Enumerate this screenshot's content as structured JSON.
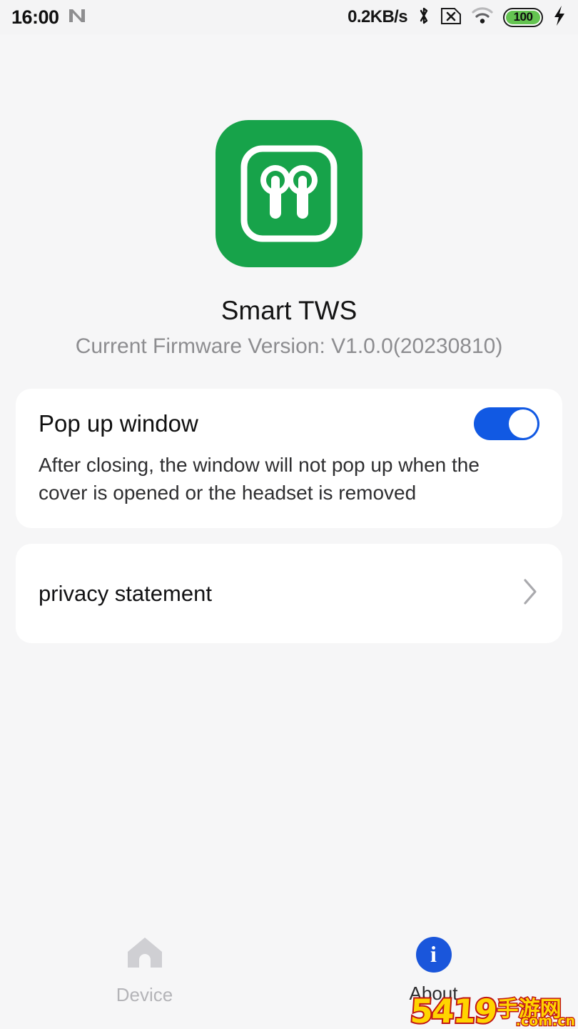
{
  "status_bar": {
    "time": "16:00",
    "nfc_icon": "nfc-icon",
    "network_speed": "0.2KB/s",
    "bluetooth_icon": "bluetooth-icon",
    "sim_icon": "sim-card-x-icon",
    "wifi_icon": "wifi-icon",
    "battery_level": "100",
    "battery_color": "#64c451",
    "charging_icon": "charging-bolt-icon"
  },
  "header": {
    "app_icon": "earbuds-icon",
    "app_icon_color": "#17a34a",
    "app_title": "Smart TWS",
    "firmware_label": "Current Firmware Version: V1.0.0(20230810)"
  },
  "settings": {
    "popup": {
      "title": "Pop up window",
      "description": "After closing, the window will not pop up when the cover is opened or the headset is removed",
      "toggle_state": "on",
      "toggle_color": "#1159e3"
    },
    "privacy": {
      "label": "privacy statement",
      "chevron_icon": "chevron-right-icon"
    }
  },
  "bottom_nav": {
    "items": [
      {
        "label": "Device",
        "icon": "home-icon",
        "active": false
      },
      {
        "label": "About",
        "icon": "info-circle-icon",
        "active": true
      }
    ],
    "active_color": "#1a56db"
  },
  "watermark": {
    "number": "5419",
    "chinese": "手游网",
    "domain": ".com.cn"
  }
}
